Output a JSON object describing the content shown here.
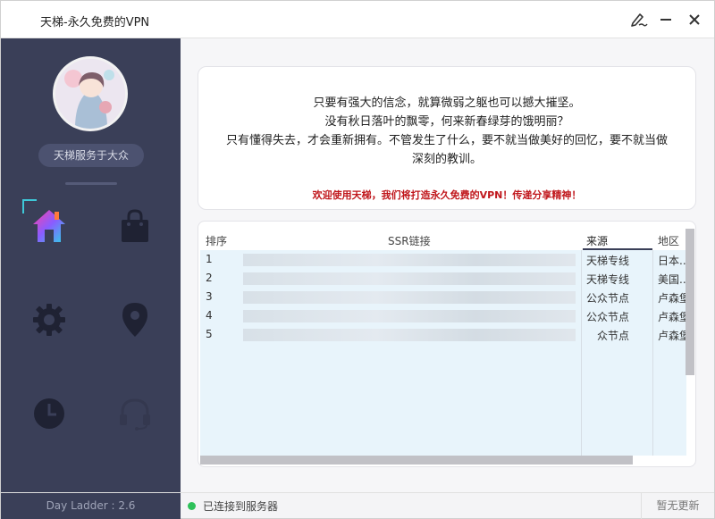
{
  "window": {
    "title": "天梯-永久免费的VPN"
  },
  "titlebar": {
    "skin_icon": "brush-icon",
    "minimize_label": "—",
    "close_label": "✕"
  },
  "sidebar": {
    "slogan": "天梯服务于大众",
    "nav": [
      {
        "name": "home",
        "icon": "home-icon"
      },
      {
        "name": "shop",
        "icon": "shopping-bag-icon"
      },
      {
        "name": "settings",
        "icon": "gear-icon"
      },
      {
        "name": "location",
        "icon": "location-pin-icon"
      },
      {
        "name": "history",
        "icon": "clock-icon"
      },
      {
        "name": "support",
        "icon": "headset-icon"
      }
    ],
    "version": "Day Ladder : 2.6"
  },
  "notice": {
    "line1": "只要有强大的信念，就算微弱之躯也可以撼大摧坚。",
    "line2": "没有秋日落叶的飘零，何来新春绿芽的饿明丽？",
    "line3": "只有懂得失去，才会重新拥有。不管发生了什么，要不就当做美好的回忆，要不就当做",
    "line4": "深刻的教训。",
    "welcome": "欢迎使用天梯，我们将打造永久免费的VPN！传递分享精神！"
  },
  "table": {
    "headers": {
      "index": "排序",
      "ssr": "SSR链接",
      "source": "来源",
      "region": "地区"
    },
    "rows": [
      {
        "index": "1",
        "source": "天梯专线",
        "region": "日本..."
      },
      {
        "index": "2",
        "source": "天梯专线",
        "region": "美国..."
      },
      {
        "index": "3",
        "source": "公众节点",
        "region": "卢森堡"
      },
      {
        "index": "4",
        "source": "公众节点",
        "region": "卢森堡"
      },
      {
        "index": "5",
        "source": "众节点",
        "region": "卢森堡"
      }
    ]
  },
  "status": {
    "connection": "已连接到服务器",
    "update": "暂无更新"
  },
  "colors": {
    "sidebar": "#3a3f58",
    "accent": "#3ec8d8",
    "connected": "#2ec15a",
    "welcome": "#c0161b"
  }
}
